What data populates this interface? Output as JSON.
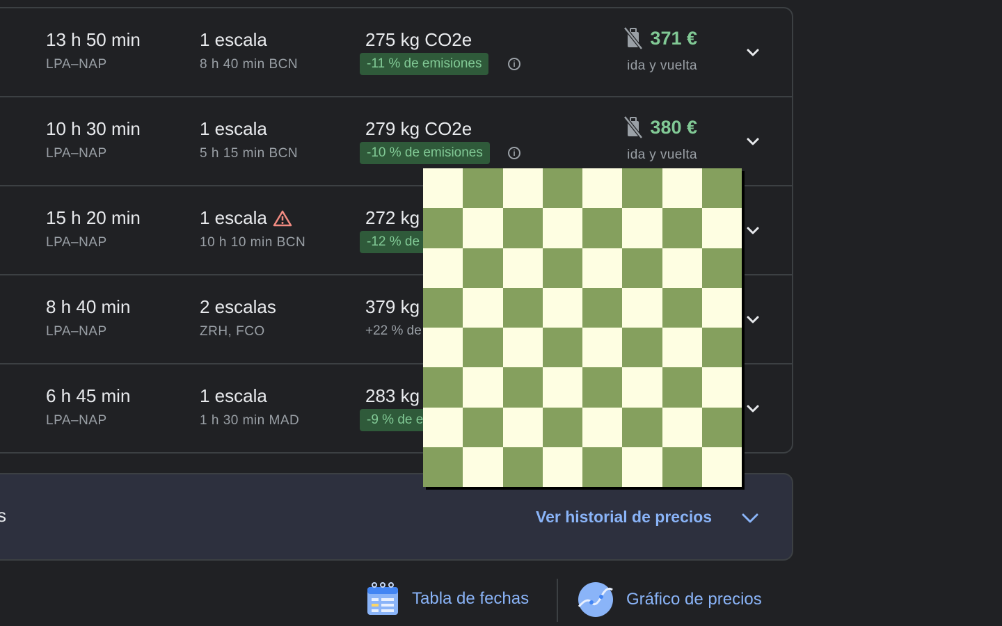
{
  "flights": [
    {
      "duration": "13 h 50 min",
      "route": "LPA–NAP",
      "stops": "1 escala",
      "stops_detail": "8 h 40 min BCN",
      "warning": false,
      "co2": "275 kg CO2e",
      "emissions": "-11 % de emisiones",
      "emissions_style": "badge",
      "price": "371 €",
      "trip_type": "ida y vuelta"
    },
    {
      "duration": "10 h 30 min",
      "route": "LPA–NAP",
      "stops": "1 escala",
      "stops_detail": "5 h 15 min BCN",
      "warning": false,
      "co2": "279 kg CO2e",
      "emissions": "-10 % de emisiones",
      "emissions_style": "badge",
      "price": "380 €",
      "trip_type": "ida y vuelta"
    },
    {
      "duration": "15 h 20 min",
      "route": "LPA–NAP",
      "stops": "1 escala",
      "stops_detail": "10 h 10 min BCN",
      "warning": true,
      "co2": "272 kg",
      "emissions": "-12 % de",
      "emissions_style": "badge",
      "price": "",
      "trip_type": ""
    },
    {
      "duration": "8 h 40 min",
      "route": "LPA–NAP",
      "stops": "2 escalas",
      "stops_detail": "ZRH, FCO",
      "warning": false,
      "co2": "379 kg",
      "emissions": "+22 % de",
      "emissions_style": "plain",
      "price": "",
      "trip_type": ""
    },
    {
      "duration": "6 h 45 min",
      "route": "LPA–NAP",
      "stops": "1 escala",
      "stops_detail": "1 h 30 min MAD",
      "warning": false,
      "co2": "283 kg",
      "emissions": "-9 % de e",
      "emissions_style": "badge",
      "price": "",
      "trip_type": ""
    }
  ],
  "history": {
    "edge_text": "s",
    "link_label": "Ver historial de precios"
  },
  "tools": {
    "dates_table": "Tabla de fechas",
    "price_graph": "Gráfico de precios"
  },
  "board": {
    "size": 8,
    "dark_color": "#85a05e",
    "light_color": "#fefee2"
  },
  "colors": {
    "background": "#202124",
    "price_green": "#81c995",
    "link_blue": "#8ab4f8",
    "warning_red": "#f28b82"
  }
}
